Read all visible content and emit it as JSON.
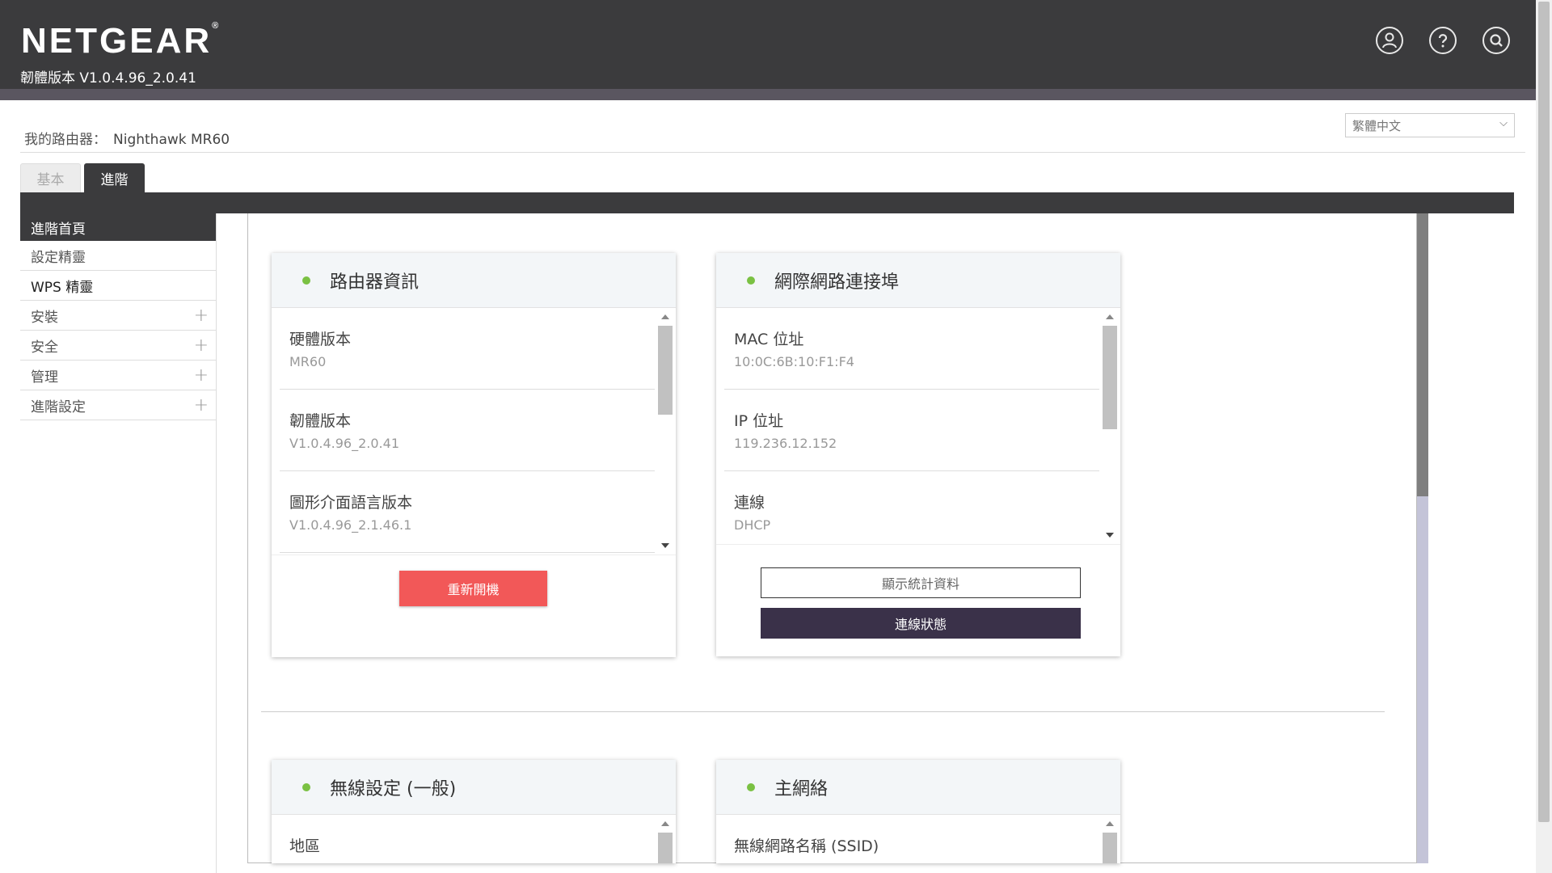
{
  "header": {
    "logo": "NETGEAR",
    "firmware_text": "韌體版本 V1.0.4.96_2.0.41",
    "icons": [
      "user-icon",
      "help-icon",
      "search-icon"
    ]
  },
  "router": {
    "label": "我的路由器：",
    "name": "Nighthawk MR60"
  },
  "language": {
    "selected": "繁體中文"
  },
  "tabs": [
    {
      "label": "基本",
      "active": false
    },
    {
      "label": "進階",
      "active": true
    }
  ],
  "sidebar": {
    "items": [
      {
        "label": "進階首頁",
        "active": true,
        "expandable": false
      },
      {
        "label": "設定精靈",
        "active": false,
        "expandable": false
      },
      {
        "label": "WPS 精靈",
        "active": false,
        "expandable": false
      },
      {
        "label": "安裝",
        "active": false,
        "expandable": true
      },
      {
        "label": "安全",
        "active": false,
        "expandable": true
      },
      {
        "label": "管理",
        "active": false,
        "expandable": true
      },
      {
        "label": "進階設定",
        "active": false,
        "expandable": true
      }
    ],
    "plus": "+"
  },
  "cards": {
    "router_info": {
      "title": "路由器資訊",
      "fields": [
        {
          "label": "硬體版本",
          "value": "MR60"
        },
        {
          "label": "韌體版本",
          "value": "V1.0.4.96_2.0.41"
        },
        {
          "label": "圖形介面語言版本",
          "value": "V1.0.4.96_2.1.46.1"
        }
      ],
      "reboot_button": "重新開機"
    },
    "internet_port": {
      "title": "網際網路連接埠",
      "fields": [
        {
          "label": "MAC 位址",
          "value": "10:0C:6B:10:F1:F4"
        },
        {
          "label": "IP 位址",
          "value": "119.236.12.152"
        },
        {
          "label": "連線",
          "value": "DHCP"
        }
      ],
      "stats_button": "顯示統計資料",
      "status_button": "連線狀態"
    },
    "wireless": {
      "title": "無線設定 (一般)",
      "fields": [
        {
          "label": "地區",
          "value": ""
        }
      ]
    },
    "main_network": {
      "title": "主網絡",
      "fields": [
        {
          "label": "無線網路名稱 (SSID)",
          "value": ""
        }
      ]
    }
  },
  "colors": {
    "header_bg": "#3b3b3d",
    "status_dot": "#7ac143",
    "reboot_button": "#f25858",
    "status_button": "#3a3149"
  }
}
